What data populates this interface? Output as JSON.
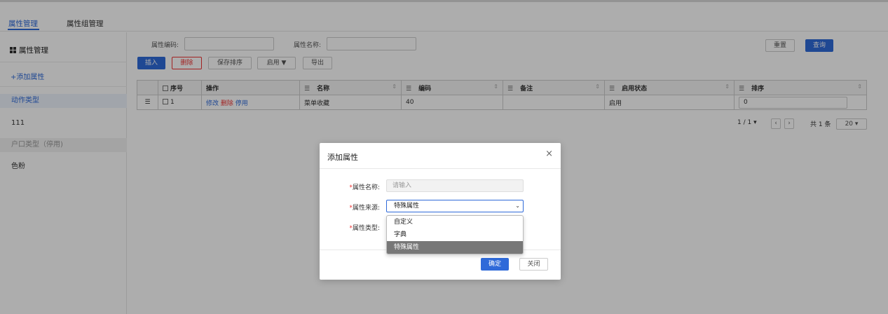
{
  "tabs": [
    {
      "label": "属性管理",
      "active": true
    },
    {
      "label": "属性组管理",
      "active": false
    }
  ],
  "sidebar": {
    "header": "属性管理",
    "add_label": "+添加属性",
    "items": [
      {
        "label": "动作类型",
        "state": "selected"
      },
      {
        "label": "111",
        "state": "normal"
      },
      {
        "label": "户口类型（停用)",
        "state": "disabled"
      },
      {
        "label": "色粉",
        "state": "normal"
      }
    ]
  },
  "search": {
    "code_label": "属性编码:",
    "name_label": "属性名称:",
    "reset_label": "重置",
    "query_label": "查询"
  },
  "toolbar": {
    "insert": "插入",
    "delete": "删除",
    "save_order": "保存排序",
    "enable": "启用 ▼",
    "export": "导出"
  },
  "table": {
    "columns": {
      "index": "序号",
      "ops": "操作",
      "name": "名称",
      "code": "编码",
      "remark": "备注",
      "status": "启用状态",
      "order": "排序"
    },
    "rows": [
      {
        "index": "1",
        "op_edit": "修改",
        "op_delete": "删除",
        "op_disable": "停用",
        "name": "菜单收藏",
        "code": "40",
        "remark": "",
        "status": "启用",
        "order": "0"
      }
    ]
  },
  "pager": {
    "page_info": "1 / 1 ▾",
    "prev": "‹",
    "next": "›",
    "total": "共 1 条",
    "page_size": "20 ▾"
  },
  "modal": {
    "title": "添加属性",
    "close_icon": "×",
    "name_label": "属性名称:",
    "name_placeholder": "请输入",
    "source_label": "属性来源:",
    "source_value": "特殊属性",
    "type_label": "属性类型:",
    "options": [
      "自定义",
      "字典",
      "特殊属性"
    ],
    "selected_option": "特殊属性",
    "confirm": "确定",
    "close": "关闭"
  },
  "colors": {
    "accent": "#2f6ad9",
    "danger": "#ee3333",
    "overlay": "rgba(0,0,0,0.32)"
  }
}
